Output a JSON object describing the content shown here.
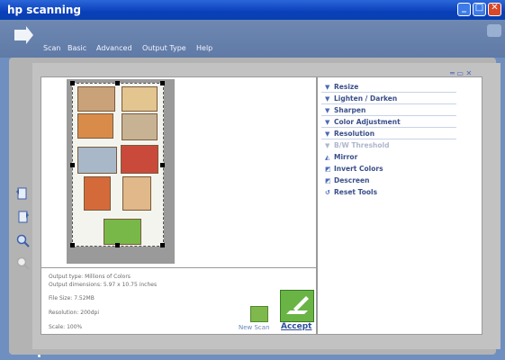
{
  "window": {
    "title": "hp scanning"
  },
  "menu": {
    "items": [
      "Scan",
      "Basic",
      "Advanced",
      "Output Type",
      "Help"
    ]
  },
  "tools": [
    {
      "label": "Resize",
      "icon": "triangle-down-icon",
      "enabled": true
    },
    {
      "label": "Lighten / Darken",
      "icon": "triangle-down-icon",
      "enabled": true
    },
    {
      "label": "Sharpen",
      "icon": "triangle-down-icon",
      "enabled": true
    },
    {
      "label": "Color Adjustment",
      "icon": "triangle-down-icon",
      "enabled": true
    },
    {
      "label": "Resolution",
      "icon": "triangle-down-icon",
      "enabled": true
    },
    {
      "label": "B/W Threshold",
      "icon": "triangle-down-icon",
      "enabled": false
    },
    {
      "label": "Mirror",
      "icon": "mirror-icon",
      "enabled": true
    },
    {
      "label": "Invert Colors",
      "icon": "invert-icon",
      "enabled": true
    },
    {
      "label": "Descreen",
      "icon": "descreen-icon",
      "enabled": true
    },
    {
      "label": "Reset Tools",
      "icon": "reset-icon",
      "enabled": true
    }
  ],
  "info": {
    "output_type": "Output type: Millions of Colors",
    "output_dimensions": "Output dimensions: 5.97 x 10.75 inches",
    "file_size": "File Size: 7.52MB",
    "resolution": "Resolution: 200dpi",
    "scale": "Scale: 100%"
  },
  "actions": {
    "new_scan": "New Scan",
    "accept": "Accept"
  },
  "colors": {
    "titlebar": "#0a3fba",
    "accent": "#3a4f8a",
    "accept_green": "#6ab446"
  }
}
